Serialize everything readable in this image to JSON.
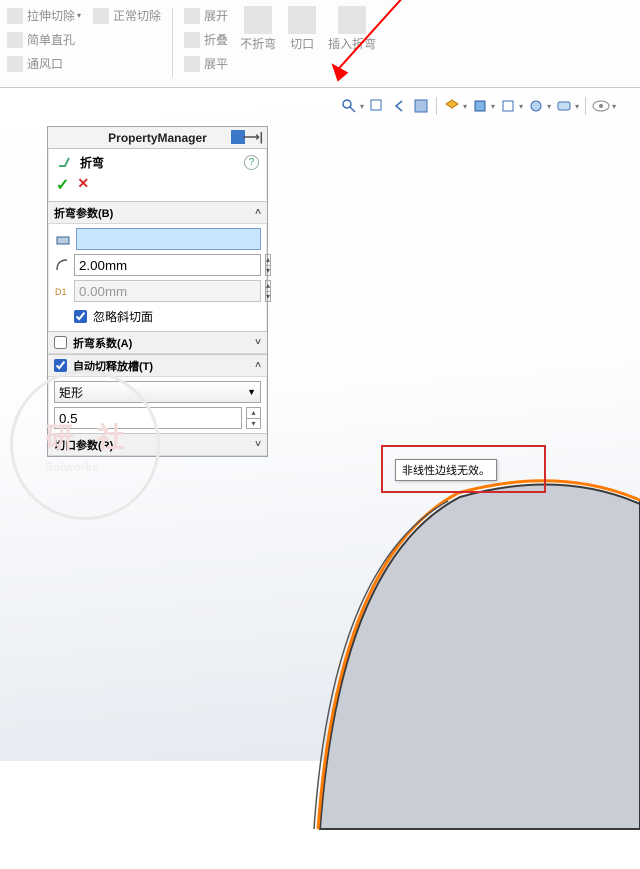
{
  "ribbon": {
    "extruded_cut": "拉伸切除",
    "normal_cut": "正常切除",
    "simple_hole": "简单直孔",
    "vent": "通风口",
    "unfold": "展开",
    "fold": "折叠",
    "flatten": "展平",
    "no_bends": "不折弯",
    "corner": "切口",
    "insert_bends": "插入折弯"
  },
  "pm": {
    "panel_title": "PropertyManager",
    "feature_name": "折弯"
  },
  "sec_params": {
    "title": "折弯参数(B)",
    "radius": "2.00mm",
    "offset": "0.00mm",
    "ignore_bevel": "忽略斜切面"
  },
  "sec_kfactor": {
    "title": "折弯系数(A)"
  },
  "sec_relief": {
    "title": "自动切释放槽(T)",
    "type": "矩形",
    "ratio": "0.5"
  },
  "sec_cut": {
    "title": "切口参数(R)"
  },
  "tooltip": "非线性边线无效。",
  "watermark": {
    "a": "研",
    "b": "社",
    "c": "Solworks"
  }
}
